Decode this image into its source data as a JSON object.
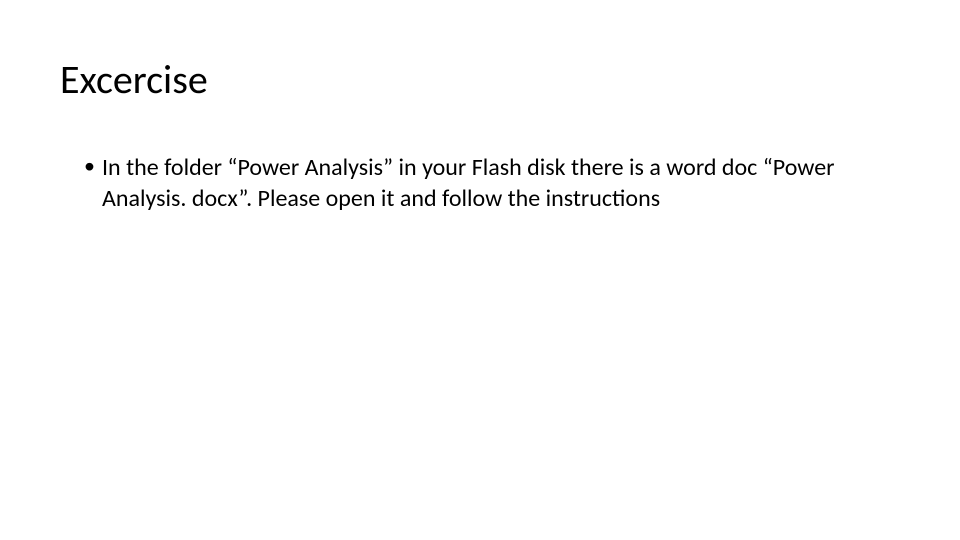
{
  "slide": {
    "title": "Excercise",
    "bullets": [
      "In the folder “Power Analysis” in your Flash disk there is a word doc “Power Analysis. docx”. Please open it and follow the instructions"
    ]
  }
}
